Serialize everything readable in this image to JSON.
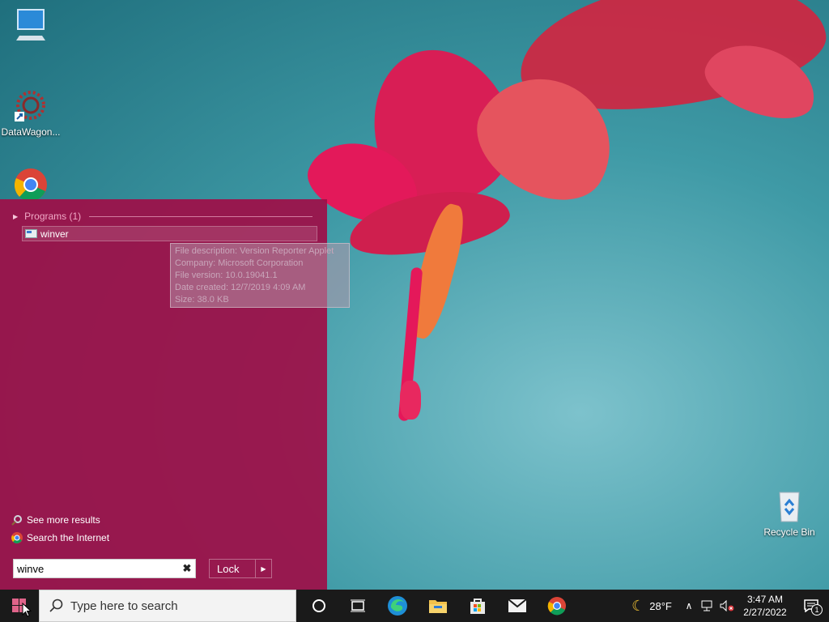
{
  "desktop": {
    "icons": [
      {
        "label": ""
      },
      {
        "label": "DataWagon..."
      },
      {
        "label": ""
      },
      {
        "label": "Recycle Bin"
      }
    ]
  },
  "start_menu": {
    "group_header": "Programs (1)",
    "program_item": "winver",
    "tooltip": {
      "line1": "File description: Version Reporter Applet",
      "line2": "Company: Microsoft Corporation",
      "line3": "File version: 10.0.19041.1",
      "line4": "Date created: 12/7/2019 4:09 AM",
      "line5": "Size: 38.0 KB"
    },
    "see_more": "See more results",
    "search_internet": "Search the Internet",
    "search_value": "winve",
    "lock_label": "Lock"
  },
  "taskbar": {
    "search_placeholder": "Type here to search",
    "weather_temp": "28°F",
    "time": "3:47 AM",
    "date": "2/27/2022",
    "notification_count": "1"
  },
  "colors": {
    "start_menu_bg": "#9e0f48",
    "taskbar_bg": "#1a1a1a",
    "desktop_bg": "#3f9aa6"
  }
}
